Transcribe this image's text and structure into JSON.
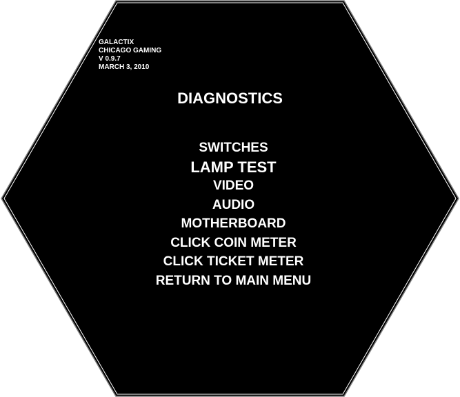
{
  "colors": {
    "screen_background": "#000000",
    "text": "#ffffff",
    "frame_outline": "#808080",
    "page_background": "#ffffff"
  },
  "info": {
    "game_name": "GALACTIX",
    "company": "CHICAGO GAMING",
    "version": "V 0.9.7",
    "date": "MARCH 3, 2010"
  },
  "title": "DIAGNOSTICS",
  "menu": {
    "selected_index": 1,
    "items": [
      {
        "label": "SWITCHES"
      },
      {
        "label": "LAMP TEST"
      },
      {
        "label": "VIDEO"
      },
      {
        "label": "AUDIO"
      },
      {
        "label": "MOTHERBOARD"
      },
      {
        "label": "CLICK COIN METER"
      },
      {
        "label": "CLICK TICKET METER"
      },
      {
        "label": "RETURN TO MAIN MENU"
      }
    ]
  }
}
